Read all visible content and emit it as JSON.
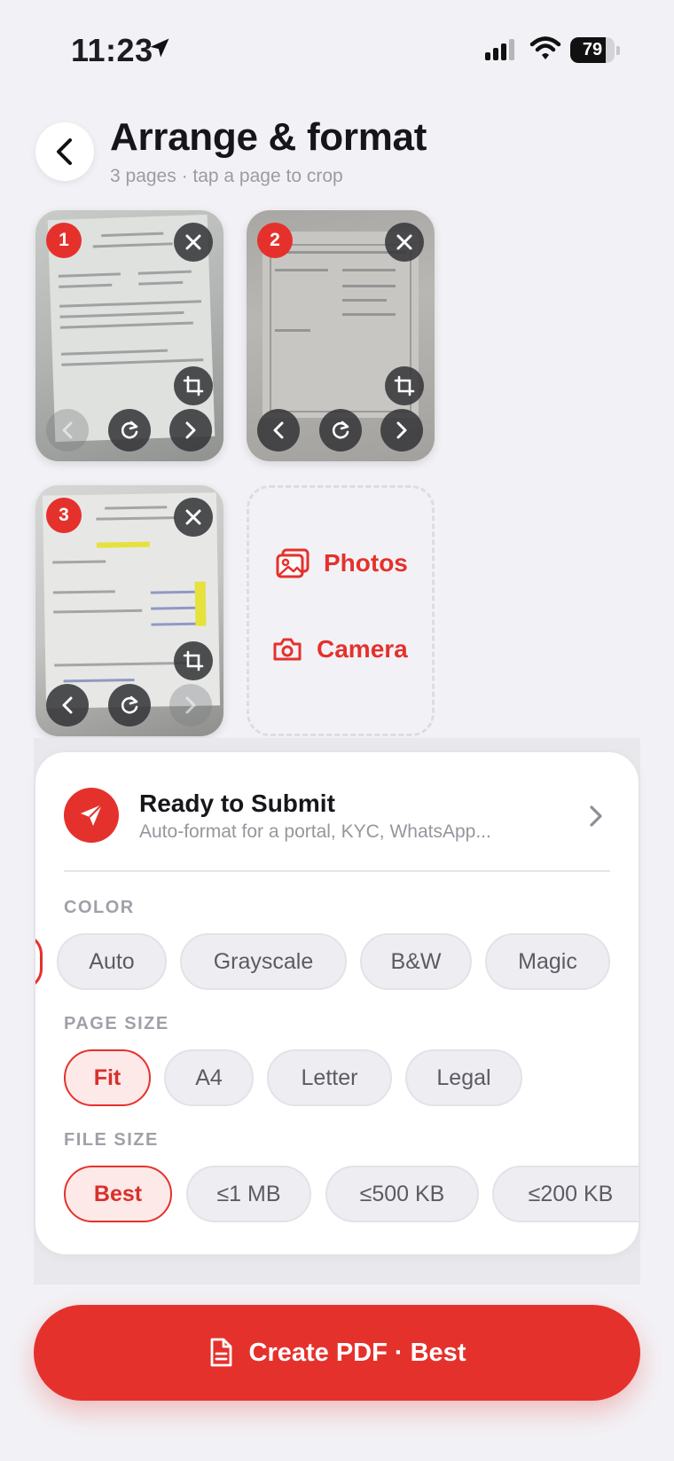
{
  "status_bar": {
    "time": "11:23",
    "battery": "79",
    "battery_level": 0.79
  },
  "header": {
    "title": "Arrange & format",
    "subtitle": "3 pages · tap a page to crop"
  },
  "pages": [
    {
      "number": "1"
    },
    {
      "number": "2"
    },
    {
      "number": "3"
    }
  ],
  "add": {
    "photos_label": "Photos",
    "camera_label": "Camera"
  },
  "submit": {
    "title": "Ready to Submit",
    "subtitle": "Auto-format for a portal, KYC, WhatsApp..."
  },
  "color": {
    "label": "COLOR",
    "options": [
      "Auto",
      "Grayscale",
      "B&W",
      "Magic"
    ]
  },
  "page_size": {
    "label": "PAGE SIZE",
    "options": [
      "Fit",
      "A4",
      "Letter",
      "Legal"
    ],
    "selected": "Fit"
  },
  "file_size": {
    "label": "FILE SIZE",
    "options": [
      "Best",
      "≤1 MB",
      "≤500 KB",
      "≤200 KB"
    ],
    "selected": "Best"
  },
  "cta": {
    "label": "Create PDF · Best"
  },
  "colors": {
    "accent": "#e5312c",
    "background": "#f2f2f6"
  }
}
